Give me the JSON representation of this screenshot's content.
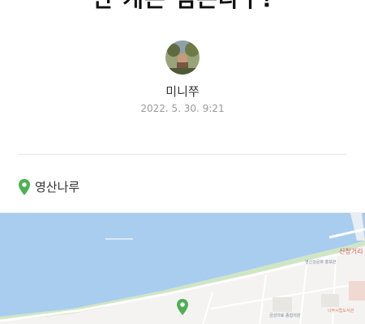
{
  "post": {
    "title": "만 개는 넘는다구!",
    "author": "미니쭈",
    "date": "2022. 5. 30. 9:21"
  },
  "place": {
    "name": "영산나루",
    "pin_color": "#4cb050"
  },
  "map": {
    "water_color": "#a9cdef",
    "land_color": "#f4f3f1",
    "labels": {
      "district": "신창거리",
      "poi_1": "영산강문화 홍보관",
      "poi_2": "금성의료 종합의원",
      "poi_3": "나주시립도서관"
    }
  }
}
